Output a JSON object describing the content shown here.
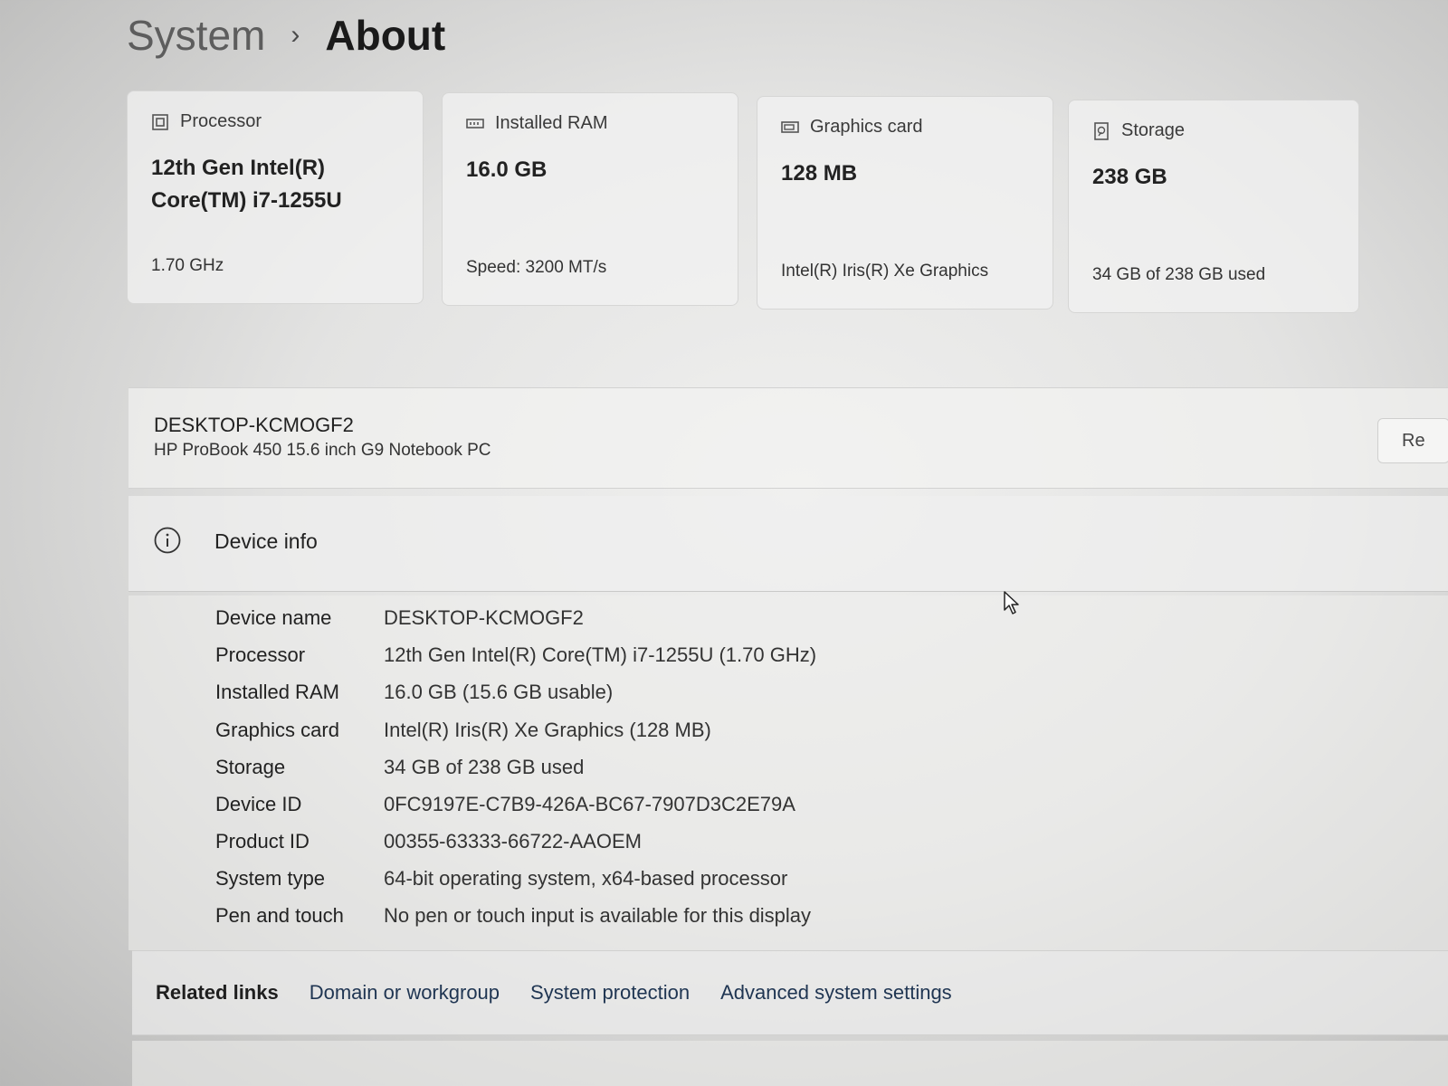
{
  "breadcrumb": {
    "parent": "System",
    "separator": "›",
    "current": "About"
  },
  "spec_cards": [
    {
      "icon": "processor-icon",
      "label": "Processor",
      "value_line1": "12th Gen Intel(R)",
      "value_line2": "Core(TM) i7-1255U",
      "sub": "1.70 GHz"
    },
    {
      "icon": "ram-icon",
      "label": "Installed RAM",
      "value_line1": "16.0 GB",
      "value_line2": "",
      "sub": "Speed: 3200 MT/s"
    },
    {
      "icon": "graphics-card-icon",
      "label": "Graphics card",
      "value_line1": "128 MB",
      "value_line2": "",
      "sub": "Intel(R) Iris(R) Xe Graphics"
    },
    {
      "icon": "storage-icon",
      "label": "Storage",
      "value_line1": "238 GB",
      "value_line2": "",
      "sub": "34 GB of 238 GB used"
    }
  ],
  "device": {
    "name": "DESKTOP-KCMOGF2",
    "model": "HP ProBook 450 15.6 inch G9 Notebook PC",
    "rename_label": "Re"
  },
  "device_info": {
    "title": "Device info",
    "rows": [
      {
        "key": "Device name",
        "value": "DESKTOP-KCMOGF2"
      },
      {
        "key": "Processor",
        "value": "12th Gen Intel(R) Core(TM) i7-1255U (1.70 GHz)"
      },
      {
        "key": "Installed RAM",
        "value": "16.0 GB (15.6 GB usable)"
      },
      {
        "key": "Graphics card",
        "value": "Intel(R) Iris(R) Xe Graphics (128 MB)"
      },
      {
        "key": "Storage",
        "value": "34 GB of 238 GB used"
      },
      {
        "key": "Device ID",
        "value": "0FC9197E-C7B9-426A-BC67-7907D3C2E79A"
      },
      {
        "key": "Product ID",
        "value": "00355-63333-66722-AAOEM"
      },
      {
        "key": "System type",
        "value": "64-bit operating system, x64-based processor"
      },
      {
        "key": "Pen and touch",
        "value": "No pen or touch input is available for this display"
      }
    ]
  },
  "related_links": {
    "label": "Related links",
    "links": [
      "Domain or workgroup",
      "System protection",
      "Advanced system settings"
    ]
  }
}
